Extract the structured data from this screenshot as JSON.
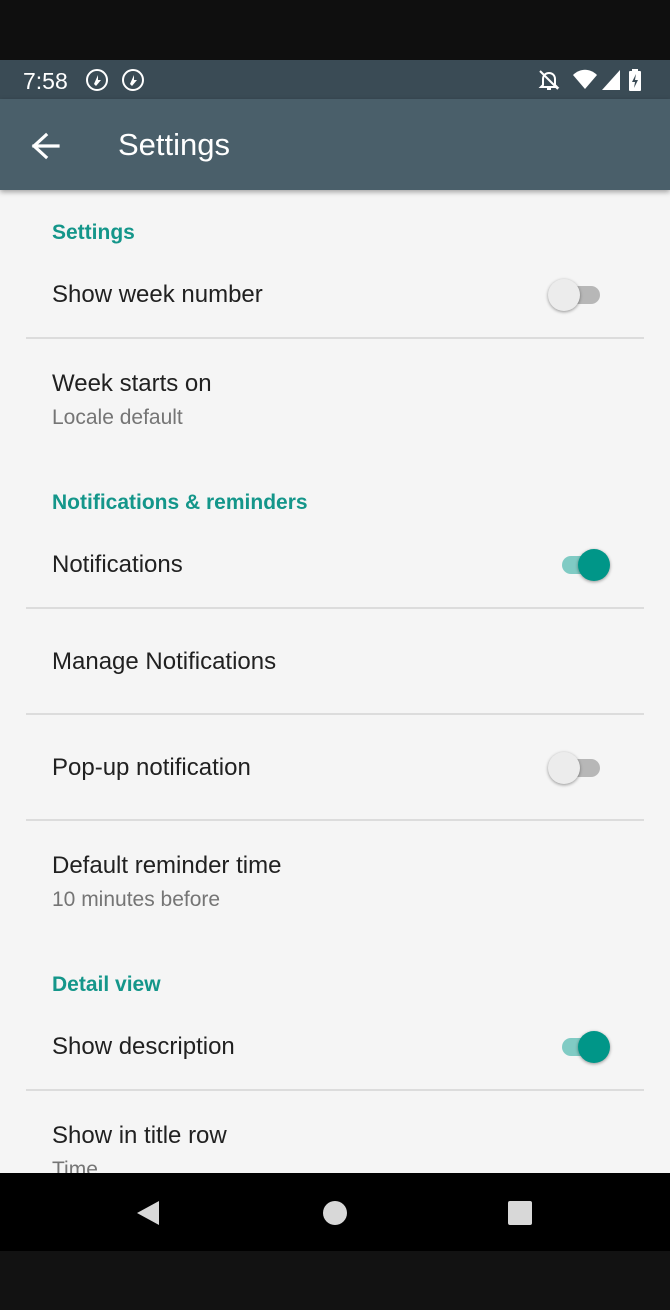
{
  "status_bar": {
    "time": "7:58",
    "icons": [
      "sync-icon",
      "sync-icon",
      "notifications-off-icon",
      "wifi-icon",
      "signal-icon",
      "battery-charging-icon"
    ]
  },
  "app_bar": {
    "title": "Settings",
    "back_icon": "arrow-back-icon"
  },
  "sections": {
    "general": {
      "header": "Settings",
      "show_week_number": {
        "title": "Show week number",
        "enabled": false
      },
      "week_starts_on": {
        "title": "Week starts on",
        "value": "Locale default"
      }
    },
    "notifications": {
      "header": "Notifications & reminders",
      "notifications": {
        "title": "Notifications",
        "enabled": true
      },
      "manage": {
        "title": "Manage Notifications"
      },
      "popup": {
        "title": "Pop-up notification",
        "enabled": false
      },
      "default_reminder": {
        "title": "Default reminder time",
        "value": "10 minutes before"
      }
    },
    "detail_view": {
      "header": "Detail view",
      "show_description": {
        "title": "Show description",
        "enabled": true
      },
      "show_in_title_row": {
        "title": "Show in title row",
        "value": "Time"
      }
    }
  },
  "colors": {
    "status_bar": "#3a4b55",
    "app_bar": "#4a5f6a",
    "accent": "#14968a",
    "switch_on_thumb": "#009688",
    "switch_on_track": "#80cbc4"
  },
  "nav_bar": {
    "icons": [
      "back-triangle-icon",
      "home-circle-icon",
      "recents-square-icon"
    ]
  }
}
